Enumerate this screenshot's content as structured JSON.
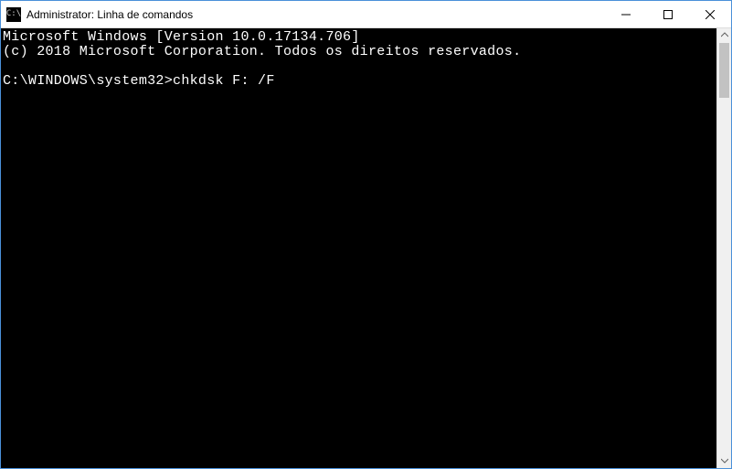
{
  "window": {
    "title": "Administrator: Linha de comandos"
  },
  "terminal": {
    "line1": "Microsoft Windows [Version 10.0.17134.706]",
    "line2": "(c) 2018 Microsoft Corporation. Todos os direitos reservados.",
    "blank": "",
    "prompt": "C:\\WINDOWS\\system32>",
    "command": "chkdsk F: /F"
  }
}
